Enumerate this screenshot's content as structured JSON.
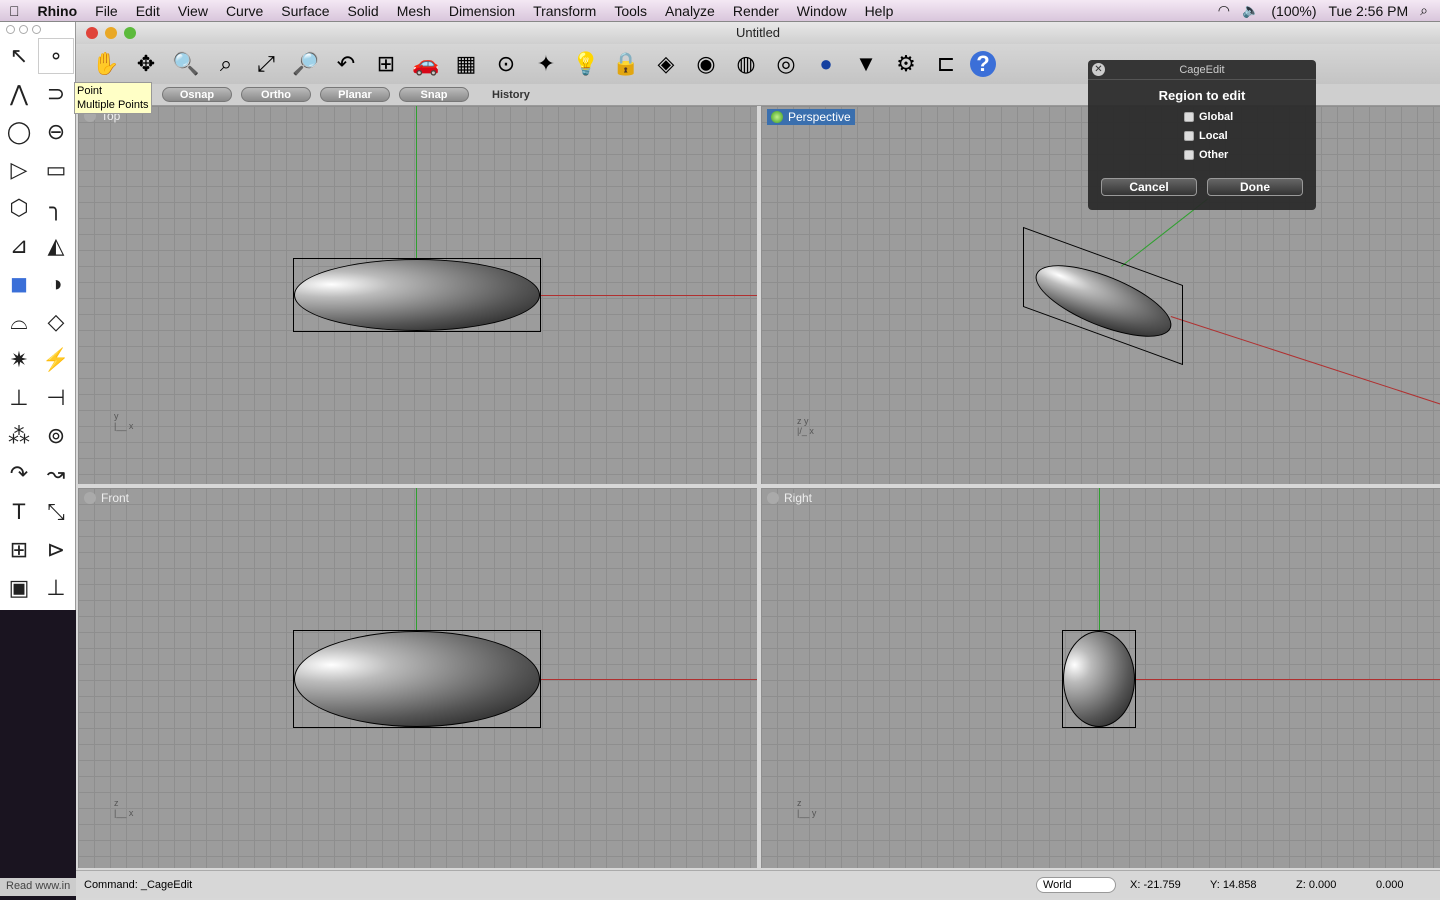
{
  "menubar": {
    "app": "Rhino",
    "items": [
      "File",
      "Edit",
      "View",
      "Curve",
      "Surface",
      "Solid",
      "Mesh",
      "Dimension",
      "Transform",
      "Tools",
      "Analyze",
      "Render",
      "Window",
      "Help"
    ],
    "battery": "(100%)",
    "clock": "Tue 2:56 PM"
  },
  "window": {
    "title": "Untitled"
  },
  "tooltip": {
    "line1": "Point",
    "line2": "Multiple Points"
  },
  "toolbar_icons": [
    "pan-icon",
    "rotate-view-icon",
    "zoom-icon",
    "zoom-window-icon",
    "zoom-extents-icon",
    "zoom-selected-icon",
    "undo-view-icon",
    "four-viewports-icon",
    "car-icon",
    "grid-icon",
    "osnap-icon",
    "lights-icon",
    "bulb-icon",
    "lock-icon",
    "layers-icon",
    "color-wheel-icon",
    "wireframe-icon",
    "shaded-icon",
    "render-icon",
    "spotlight-icon",
    "options-gear-icon",
    "properties-icon",
    "help-icon"
  ],
  "left_tools": [
    "select-icon",
    "point-icon",
    "polyline-icon",
    "curve-icon",
    "circle-icon",
    "ellipse-icon",
    "arc-icon",
    "rectangle-icon",
    "polygon-icon",
    "fillet-icon",
    "surface-icon",
    "surface-edit-icon",
    "box-icon",
    "boolean-icon",
    "cylinder-icon",
    "mesh-icon",
    "explode-icon",
    "split-icon",
    "trim-icon",
    "extend-icon",
    "group-icon",
    "ungroup-icon",
    "offset-icon",
    "blend-icon",
    "text-icon",
    "scale-icon",
    "array-icon",
    "drafting-icon",
    "solid-tools-icon",
    "dimension-icon"
  ],
  "buttons": {
    "osnap": "Osnap",
    "ortho": "Ortho",
    "planar": "Planar",
    "snap": "Snap",
    "history": "History"
  },
  "viewports": {
    "top": "Top",
    "perspective": "Perspective",
    "front": "Front",
    "right": "Right"
  },
  "dialog": {
    "title": "CageEdit",
    "heading": "Region to edit",
    "options": [
      "Global",
      "Local",
      "Other"
    ],
    "cancel": "Cancel",
    "done": "Done"
  },
  "status": {
    "left_text": "Read www.in",
    "command": "Command:  _CageEdit",
    "cplane": "World",
    "x": "X: -21.759",
    "y": "Y: 14.858",
    "z": "Z: 0.000",
    "value": "0.000"
  },
  "colors": {
    "x_axis": "#b03030",
    "y_axis": "#30a030",
    "accent": "#3a6fae"
  }
}
